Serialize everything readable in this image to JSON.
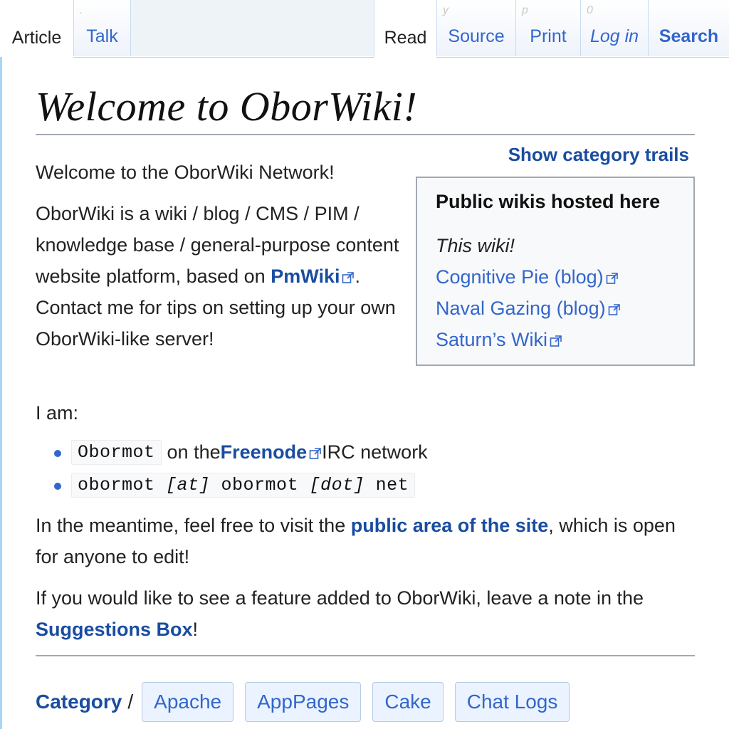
{
  "tabs": {
    "article": "Article",
    "talk": "Talk",
    "read": "Read",
    "source": "Source",
    "print": "Print",
    "login": "Log in",
    "search": "Search",
    "hints": {
      "source": "y",
      "print": "p",
      "login": "0",
      "talk": "."
    }
  },
  "page": {
    "title": "Welcome to OborWiki!",
    "category_trails": "Show category trails",
    "intro": "Welcome to the OborWiki Network!",
    "desc_before": "OborWiki is a wiki / blog / CMS / PIM / knowledge base / general-purpose content website platform, based on ",
    "desc_link": "PmWiki",
    "desc_after": ". Contact me for tips on setting up your own OborWiki-like server!",
    "i_am": "I am:",
    "bullets": [
      {
        "code": "Obormot",
        "before": "on the ",
        "link": "Freenode",
        "after": " IRC network"
      },
      {
        "code_parts": [
          "obormot ",
          "[at]",
          " obormot ",
          "[dot]",
          " net"
        ]
      }
    ],
    "meantime_before": "In the meantime, feel free to visit the ",
    "meantime_link": "public area of the site",
    "meantime_after": ", which is open for anyone to edit!",
    "suggest_before": "If you would like to see a feature added to OborWiki, leave a note in the ",
    "suggest_link": "Suggestions Box",
    "suggest_after": "!"
  },
  "infobox": {
    "title": "Public wikis hosted here",
    "this_wiki": "This wiki!",
    "links": [
      "Cognitive Pie (blog)",
      "Naval Gazing (blog)",
      "Saturn’s Wiki"
    ]
  },
  "categories": {
    "label": "Category",
    "slash": "/",
    "items": [
      "Apache",
      "AppPages",
      "Cake",
      "Chat Logs"
    ]
  },
  "colors": {
    "link": "#3366cc",
    "bold_link": "#1a4da0",
    "tab_border": "#a7d7f9",
    "rule": "#a2a9b1"
  }
}
